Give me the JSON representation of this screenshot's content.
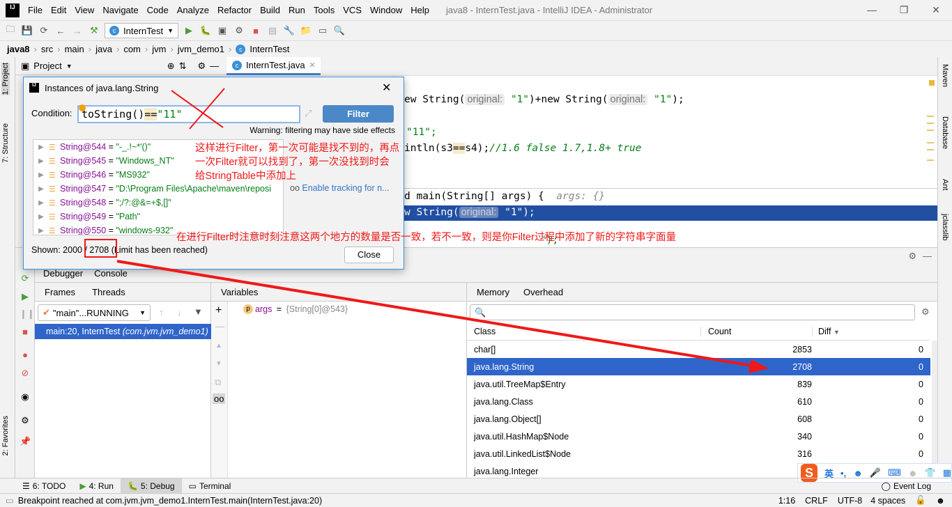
{
  "app": {
    "title": "java8 - InternTest.java - IntelliJ IDEA - Administrator",
    "logo": "IJ"
  },
  "menu": [
    "File",
    "Edit",
    "View",
    "Navigate",
    "Code",
    "Analyze",
    "Refactor",
    "Build",
    "Run",
    "Tools",
    "VCS",
    "Window",
    "Help"
  ],
  "toolbar": {
    "run_config": "InternTest"
  },
  "breadcrumb": [
    "java8",
    "src",
    "main",
    "java",
    "com",
    "jvm",
    "jvm_demo1",
    "InternTest"
  ],
  "left_tabs": [
    "1: Project",
    "7: Structure",
    "2: Favorites"
  ],
  "right_tabs": [
    "Maven",
    "Database",
    "Ant",
    "jclasslib"
  ],
  "project_panel": {
    "label": "Project"
  },
  "editor": {
    "tab": "InternTest.java",
    "lines": {
      "l1a": "ew String(",
      "hint": "original:",
      "s1": "\"1\"",
      "l1b": ")+new String(",
      "l1c": ");",
      "l2": "\"11\";",
      "l2a": "11\"",
      "l3a": "intln(s3",
      "l3op": "==",
      "l3b": "s4);",
      "l3c": "//1.6 false 1.7,1.8+ true",
      "l4": "d main(String[] args) {",
      "l4h": "args: {}",
      "l5a": "w String(",
      "l5b": "\"1\");",
      "l6": "\");"
    }
  },
  "debug": {
    "tabs": [
      "Debugger",
      "Console"
    ],
    "frames_tabs": [
      "Frames",
      "Threads"
    ],
    "thread": "\"main\"...RUNNING",
    "frame_name": "main:20, InternTest",
    "frame_pkg": "(com.jvm.jvm_demo1)",
    "variables_label": "Variables",
    "var": {
      "name": "args",
      "eq": " = ",
      "value": "{String[0]@543}"
    },
    "memory_tabs": [
      "Memory",
      "Overhead"
    ],
    "memory_search_placeholder": "",
    "columns": [
      "Class",
      "Count",
      "Diff"
    ],
    "rows": [
      {
        "cls": "char[]",
        "count": "2853",
        "diff": "0"
      },
      {
        "cls": "java.lang.String",
        "count": "2708",
        "diff": "0",
        "selected": true
      },
      {
        "cls": "java.util.TreeMap$Entry",
        "count": "839",
        "diff": "0"
      },
      {
        "cls": "java.lang.Class",
        "count": "610",
        "diff": "0"
      },
      {
        "cls": "java.lang.Object[]",
        "count": "608",
        "diff": "0"
      },
      {
        "cls": "java.util.HashMap$Node",
        "count": "340",
        "diff": "0"
      },
      {
        "cls": "java.util.LinkedList$Node",
        "count": "316",
        "diff": "0"
      },
      {
        "cls": "java.lang.Integer",
        "count": "",
        "diff": ""
      }
    ]
  },
  "dialog": {
    "title": "Instances of java.lang.String",
    "condition_label": "Condition:",
    "condition_value": "toString()==\"11\"",
    "cond_a": "toString()",
    "cond_op": "==",
    "cond_b": "\"11\"",
    "filter_button": "Filter",
    "warning": "Warning: filtering may have side effects",
    "instances": [
      {
        "name": "String@544",
        "value": "\"-_.!~*'()\""
      },
      {
        "name": "String@545",
        "value": "\"Windows_NT\""
      },
      {
        "name": "String@546",
        "value": "\"MS932\""
      },
      {
        "name": "String@547",
        "value": "\"D:\\Program Files\\Apache\\maven\\reposi"
      },
      {
        "name": "String@548",
        "value": "\";/?:@&=+$,[]\""
      },
      {
        "name": "String@549",
        "value": "\"Path\""
      },
      {
        "name": "String@550",
        "value": "\"windows-932\""
      }
    ],
    "tracking_link": "Enable tracking for n...",
    "shown_prefix": "Shown: 2000 / ",
    "shown_total": "2708",
    "shown_suffix": " (Limit has been reached)",
    "close_button": "Close"
  },
  "annotations": {
    "a1": "这样进行Filter，第一次可能是找不到的，再点",
    "a2": "一次Filter就可以找到了，第一次没找到时会",
    "a3": "给StringTable中添加上",
    "a4": "在进行Filter时注意时刻注意这两个地方的数量是否一致，若不一致，则是你Filter过程中添加了新的字符串字面量",
    "color": "#f01818"
  },
  "ime": {
    "lang": "英",
    "punct": "•,"
  },
  "bottom_tabs": [
    "6: TODO",
    "4: Run",
    "5: Debug",
    "Terminal"
  ],
  "event_log": "Event Log",
  "status": {
    "message": "Breakpoint reached at com.jvm.jvm_demo1.InternTest.main(InternTest.java:20)",
    "position": "1:16",
    "line_sep": "CRLF",
    "encoding": "UTF-8",
    "indent": "4 spaces"
  },
  "colors": {
    "selection": "#2f65ca",
    "accent": "#4083c9",
    "filter_button": "#4a88c7"
  }
}
